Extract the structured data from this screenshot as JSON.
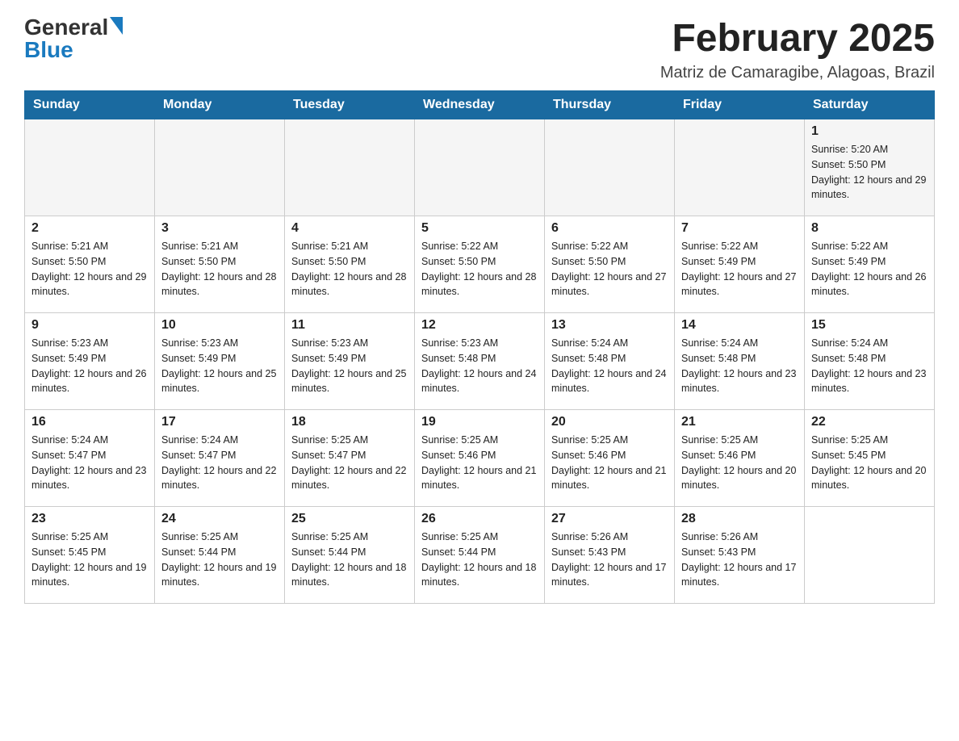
{
  "header": {
    "logo_text1": "General",
    "logo_text2": "Blue",
    "month_title": "February 2025",
    "subtitle": "Matriz de Camaragibe, Alagoas, Brazil"
  },
  "weekdays": [
    "Sunday",
    "Monday",
    "Tuesday",
    "Wednesday",
    "Thursday",
    "Friday",
    "Saturday"
  ],
  "weeks": [
    [
      {
        "day": "",
        "sunrise": "",
        "sunset": "",
        "daylight": ""
      },
      {
        "day": "",
        "sunrise": "",
        "sunset": "",
        "daylight": ""
      },
      {
        "day": "",
        "sunrise": "",
        "sunset": "",
        "daylight": ""
      },
      {
        "day": "",
        "sunrise": "",
        "sunset": "",
        "daylight": ""
      },
      {
        "day": "",
        "sunrise": "",
        "sunset": "",
        "daylight": ""
      },
      {
        "day": "",
        "sunrise": "",
        "sunset": "",
        "daylight": ""
      },
      {
        "day": "1",
        "sunrise": "Sunrise: 5:20 AM",
        "sunset": "Sunset: 5:50 PM",
        "daylight": "Daylight: 12 hours and 29 minutes."
      }
    ],
    [
      {
        "day": "2",
        "sunrise": "Sunrise: 5:21 AM",
        "sunset": "Sunset: 5:50 PM",
        "daylight": "Daylight: 12 hours and 29 minutes."
      },
      {
        "day": "3",
        "sunrise": "Sunrise: 5:21 AM",
        "sunset": "Sunset: 5:50 PM",
        "daylight": "Daylight: 12 hours and 28 minutes."
      },
      {
        "day": "4",
        "sunrise": "Sunrise: 5:21 AM",
        "sunset": "Sunset: 5:50 PM",
        "daylight": "Daylight: 12 hours and 28 minutes."
      },
      {
        "day": "5",
        "sunrise": "Sunrise: 5:22 AM",
        "sunset": "Sunset: 5:50 PM",
        "daylight": "Daylight: 12 hours and 28 minutes."
      },
      {
        "day": "6",
        "sunrise": "Sunrise: 5:22 AM",
        "sunset": "Sunset: 5:50 PM",
        "daylight": "Daylight: 12 hours and 27 minutes."
      },
      {
        "day": "7",
        "sunrise": "Sunrise: 5:22 AM",
        "sunset": "Sunset: 5:49 PM",
        "daylight": "Daylight: 12 hours and 27 minutes."
      },
      {
        "day": "8",
        "sunrise": "Sunrise: 5:22 AM",
        "sunset": "Sunset: 5:49 PM",
        "daylight": "Daylight: 12 hours and 26 minutes."
      }
    ],
    [
      {
        "day": "9",
        "sunrise": "Sunrise: 5:23 AM",
        "sunset": "Sunset: 5:49 PM",
        "daylight": "Daylight: 12 hours and 26 minutes."
      },
      {
        "day": "10",
        "sunrise": "Sunrise: 5:23 AM",
        "sunset": "Sunset: 5:49 PM",
        "daylight": "Daylight: 12 hours and 25 minutes."
      },
      {
        "day": "11",
        "sunrise": "Sunrise: 5:23 AM",
        "sunset": "Sunset: 5:49 PM",
        "daylight": "Daylight: 12 hours and 25 minutes."
      },
      {
        "day": "12",
        "sunrise": "Sunrise: 5:23 AM",
        "sunset": "Sunset: 5:48 PM",
        "daylight": "Daylight: 12 hours and 24 minutes."
      },
      {
        "day": "13",
        "sunrise": "Sunrise: 5:24 AM",
        "sunset": "Sunset: 5:48 PM",
        "daylight": "Daylight: 12 hours and 24 minutes."
      },
      {
        "day": "14",
        "sunrise": "Sunrise: 5:24 AM",
        "sunset": "Sunset: 5:48 PM",
        "daylight": "Daylight: 12 hours and 23 minutes."
      },
      {
        "day": "15",
        "sunrise": "Sunrise: 5:24 AM",
        "sunset": "Sunset: 5:48 PM",
        "daylight": "Daylight: 12 hours and 23 minutes."
      }
    ],
    [
      {
        "day": "16",
        "sunrise": "Sunrise: 5:24 AM",
        "sunset": "Sunset: 5:47 PM",
        "daylight": "Daylight: 12 hours and 23 minutes."
      },
      {
        "day": "17",
        "sunrise": "Sunrise: 5:24 AM",
        "sunset": "Sunset: 5:47 PM",
        "daylight": "Daylight: 12 hours and 22 minutes."
      },
      {
        "day": "18",
        "sunrise": "Sunrise: 5:25 AM",
        "sunset": "Sunset: 5:47 PM",
        "daylight": "Daylight: 12 hours and 22 minutes."
      },
      {
        "day": "19",
        "sunrise": "Sunrise: 5:25 AM",
        "sunset": "Sunset: 5:46 PM",
        "daylight": "Daylight: 12 hours and 21 minutes."
      },
      {
        "day": "20",
        "sunrise": "Sunrise: 5:25 AM",
        "sunset": "Sunset: 5:46 PM",
        "daylight": "Daylight: 12 hours and 21 minutes."
      },
      {
        "day": "21",
        "sunrise": "Sunrise: 5:25 AM",
        "sunset": "Sunset: 5:46 PM",
        "daylight": "Daylight: 12 hours and 20 minutes."
      },
      {
        "day": "22",
        "sunrise": "Sunrise: 5:25 AM",
        "sunset": "Sunset: 5:45 PM",
        "daylight": "Daylight: 12 hours and 20 minutes."
      }
    ],
    [
      {
        "day": "23",
        "sunrise": "Sunrise: 5:25 AM",
        "sunset": "Sunset: 5:45 PM",
        "daylight": "Daylight: 12 hours and 19 minutes."
      },
      {
        "day": "24",
        "sunrise": "Sunrise: 5:25 AM",
        "sunset": "Sunset: 5:44 PM",
        "daylight": "Daylight: 12 hours and 19 minutes."
      },
      {
        "day": "25",
        "sunrise": "Sunrise: 5:25 AM",
        "sunset": "Sunset: 5:44 PM",
        "daylight": "Daylight: 12 hours and 18 minutes."
      },
      {
        "day": "26",
        "sunrise": "Sunrise: 5:25 AM",
        "sunset": "Sunset: 5:44 PM",
        "daylight": "Daylight: 12 hours and 18 minutes."
      },
      {
        "day": "27",
        "sunrise": "Sunrise: 5:26 AM",
        "sunset": "Sunset: 5:43 PM",
        "daylight": "Daylight: 12 hours and 17 minutes."
      },
      {
        "day": "28",
        "sunrise": "Sunrise: 5:26 AM",
        "sunset": "Sunset: 5:43 PM",
        "daylight": "Daylight: 12 hours and 17 minutes."
      },
      {
        "day": "",
        "sunrise": "",
        "sunset": "",
        "daylight": ""
      }
    ]
  ]
}
